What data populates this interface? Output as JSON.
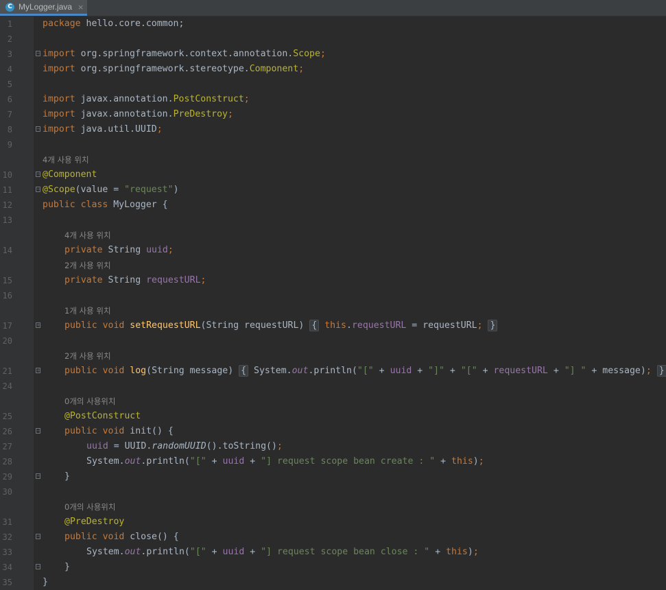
{
  "tab": {
    "title": "MyLogger.java",
    "icon": "C",
    "close": "×"
  },
  "lines": {
    "l1": {
      "num": "1",
      "a": "package",
      "b": " hello.core.common;"
    },
    "l2": {
      "num": "2"
    },
    "l3": {
      "num": "3",
      "a": "import",
      "b": " org.springframework.context.annotation.",
      "c": "Scope",
      "d": ";"
    },
    "l4": {
      "num": "4",
      "a": "import",
      "b": " org.springframework.stereotype.",
      "c": "Component",
      "d": ";"
    },
    "l5": {
      "num": "5"
    },
    "l6": {
      "num": "6",
      "a": "import",
      "b": " javax.annotation.",
      "c": "PostConstruct",
      "d": ";"
    },
    "l7": {
      "num": "7",
      "a": "import",
      "b": " javax.annotation.",
      "c": "PreDestroy",
      "d": ";"
    },
    "l8": {
      "num": "8",
      "a": "import",
      "b": " java.util.UUID",
      "d": ";"
    },
    "l9": {
      "num": "9"
    },
    "h1": "4개 사용 위치",
    "l10": {
      "num": "10",
      "a": "@Component"
    },
    "l11": {
      "num": "11",
      "a": "@Scope",
      "b": "(value = ",
      "c": "\"request\"",
      "d": ")"
    },
    "l12": {
      "num": "12",
      "a": "public class",
      "b": " MyLogger {"
    },
    "l13": {
      "num": "13"
    },
    "h2": "4개 사용 위치",
    "l14": {
      "num": "14",
      "a": "private",
      "b": " String ",
      "c": "uuid",
      "d": ";"
    },
    "h3": "2개 사용 위치",
    "l15": {
      "num": "15",
      "a": "private",
      "b": " String ",
      "c": "requestURL",
      "d": ";"
    },
    "l16": {
      "num": "16"
    },
    "h4": "1개 사용 위치",
    "l17": {
      "num": "17",
      "a": "public void",
      "b": " ",
      "c": "setRequestURL",
      "d": "(String requestURL)",
      "e": "{",
      "f": "this",
      "g": ".",
      "h": "requestURL",
      "i": " = requestURL",
      "j": ";",
      "k": "}"
    },
    "l20": {
      "num": "20"
    },
    "h5": "2개 사용 위치",
    "l21": {
      "num": "21",
      "a": "public void",
      "b": " ",
      "c": "log",
      "d": "(String message)",
      "e": "{",
      "f": " System.",
      "g": "out",
      "h": ".println(",
      "i": "\"[\"",
      "j": " + ",
      "k": "uuid",
      "l": " + ",
      "m": "\"]\"",
      "n": " + ",
      "o": "\"[\"",
      "p": " + ",
      "q": "requestURL",
      "r": " + ",
      "s": "\"] \"",
      "t": " + message)",
      "u": ";",
      "v": "}"
    },
    "l24": {
      "num": "24"
    },
    "h6": "0개의 사용위치",
    "l25": {
      "num": "25",
      "a": "@PostConstruct"
    },
    "l26": {
      "num": "26",
      "a": "public void",
      "b": " init() {"
    },
    "l27": {
      "num": "27",
      "a": "uuid",
      "b": " = UUID.",
      "c": "randomUUID",
      "d": "().toString()",
      "e": ";"
    },
    "l28": {
      "num": "28",
      "a": "System.",
      "b": "out",
      "c": ".println(",
      "d": "\"[\"",
      "e": " + ",
      "f": "uuid",
      "g": " + ",
      "h": "\"] request scope bean create : \"",
      "i": " + ",
      "j": "this",
      "k": ")",
      "l": ";"
    },
    "l29": {
      "num": "29",
      "a": "}"
    },
    "l30": {
      "num": "30"
    },
    "h7": "0개의 사용위치",
    "l31": {
      "num": "31",
      "a": "@PreDestroy"
    },
    "l32": {
      "num": "32",
      "a": "public void",
      "b": " close() {"
    },
    "l33": {
      "num": "33",
      "a": "System.",
      "b": "out",
      "c": ".println(",
      "d": "\"[\"",
      "e": " + ",
      "f": "uuid",
      "g": " + ",
      "h": "\"] request scope bean close : \"",
      "i": " + ",
      "j": "this",
      "k": ")",
      "l": ";"
    },
    "l34": {
      "num": "34",
      "a": "}"
    },
    "l35": {
      "num": "35",
      "a": "}"
    }
  }
}
